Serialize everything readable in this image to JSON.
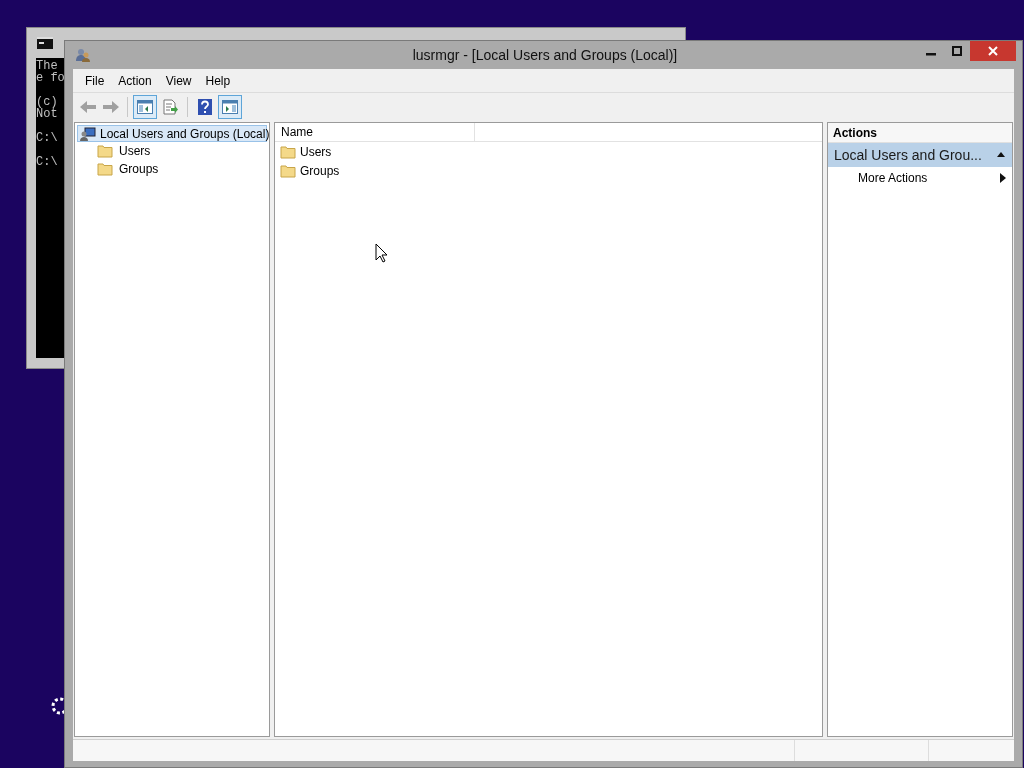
{
  "console_window": {
    "blocks": [
      [
        "The",
        "e fo"
      ],
      [
        "(c)",
        "Not"
      ],
      [
        "C:\\"
      ],
      [
        "C:\\"
      ]
    ]
  },
  "window": {
    "title": "lusrmgr - [Local Users and Groups (Local)]"
  },
  "menu": [
    "File",
    "Action",
    "View",
    "Help"
  ],
  "toolbar": [
    {
      "kind": "back",
      "disabled": true
    },
    {
      "kind": "forward",
      "disabled": true
    },
    {
      "kind": "separator"
    },
    {
      "kind": "tree",
      "selected": true
    },
    {
      "kind": "export",
      "selected": false
    },
    {
      "kind": "separator"
    },
    {
      "kind": "help",
      "selected": false
    },
    {
      "kind": "actionpane",
      "selected": true
    }
  ],
  "tree": {
    "label": "Local Users and Groups (Local)",
    "selected": true,
    "children": [
      {
        "label": "Users",
        "selected": false
      },
      {
        "label": "Groups",
        "selected": false
      }
    ]
  },
  "list": {
    "columns": [
      "Name"
    ],
    "rows": [
      "Users",
      "Groups"
    ]
  },
  "actions": {
    "title": "Actions",
    "section": {
      "label": "Local Users and Grou...",
      "expanded": true
    },
    "items": [
      "More Actions"
    ]
  }
}
